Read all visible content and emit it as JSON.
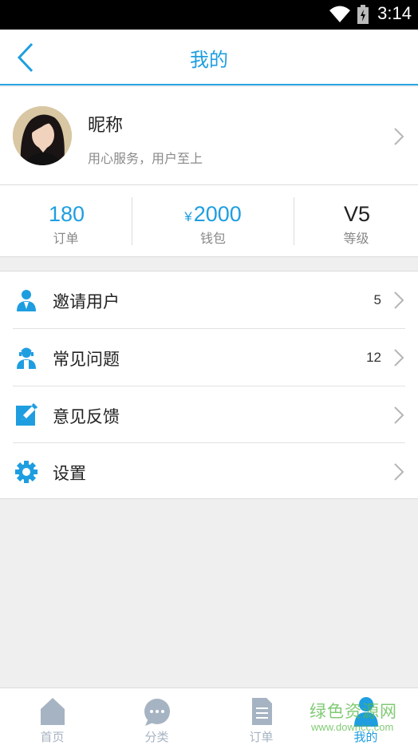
{
  "status_bar": {
    "time": "3:14"
  },
  "header": {
    "title": "我的"
  },
  "profile": {
    "nickname": "昵称",
    "motto": "用心服务，用户至上"
  },
  "stats": [
    {
      "value": "180",
      "currency": "",
      "label": "订单"
    },
    {
      "value": "2000",
      "currency": "¥",
      "label": "钱包"
    },
    {
      "value": "V5",
      "currency": "",
      "label": "等级"
    }
  ],
  "menu": {
    "items": [
      {
        "label": "邀请用户",
        "count": "5",
        "icon": "invite-user-icon"
      },
      {
        "label": "常见问题",
        "count": "12",
        "icon": "faq-icon"
      },
      {
        "label": "意见反馈",
        "count": "",
        "icon": "feedback-icon"
      },
      {
        "label": "设置",
        "count": "",
        "icon": "settings-gear-icon"
      }
    ]
  },
  "tabbar": {
    "tabs": [
      {
        "label": "首页",
        "icon": "home-icon"
      },
      {
        "label": "分类",
        "icon": "chat-bubble-icon"
      },
      {
        "label": "订单",
        "icon": "document-icon"
      },
      {
        "label": "我的",
        "icon": "person-icon",
        "active": true
      }
    ]
  },
  "watermark": {
    "line1": "绿色资源网",
    "line2": "www.downcc.com"
  },
  "colors": {
    "accent": "#1e9ee0",
    "tab_inactive": "#a6b3c2",
    "background": "#efefef"
  }
}
